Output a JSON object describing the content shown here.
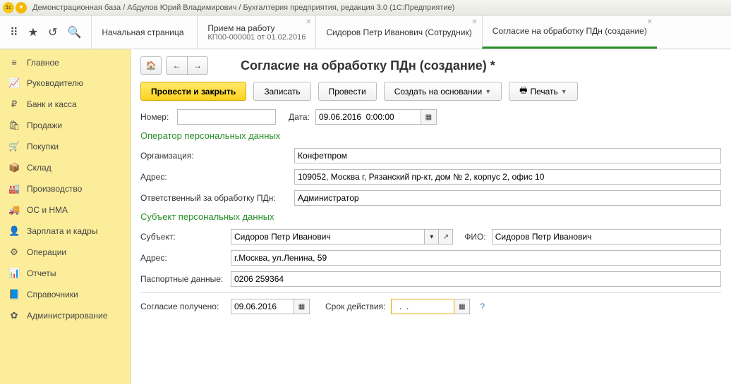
{
  "titlebar": {
    "text": "Демонстрационная база / Абдулов Юрий Владимирович / Бухгалтерия предприятия, редакция 3.0  (1С:Предприятие)"
  },
  "tabs": [
    {
      "title": "Начальная страница",
      "sub": ""
    },
    {
      "title": "Прием на работу",
      "sub": "КП00-000001 от 01.02.2016"
    },
    {
      "title": "Сидоров Петр Иванович (Сотрудник)",
      "sub": ""
    },
    {
      "title": "Согласие на обработку ПДн (создание)",
      "sub": ""
    }
  ],
  "sidebar": [
    {
      "icon": "≡",
      "label": "Главное"
    },
    {
      "icon": "📈",
      "label": "Руководителю"
    },
    {
      "icon": "₽",
      "label": "Банк и касса"
    },
    {
      "icon": "🛍",
      "label": "Продажи"
    },
    {
      "icon": "🛒",
      "label": "Покупки"
    },
    {
      "icon": "📦",
      "label": "Склад"
    },
    {
      "icon": "🏭",
      "label": "Производство"
    },
    {
      "icon": "🚚",
      "label": "ОС и НМА"
    },
    {
      "icon": "👤",
      "label": "Зарплата и кадры"
    },
    {
      "icon": "⚙",
      "label": "Операции"
    },
    {
      "icon": "📊",
      "label": "Отчеты"
    },
    {
      "icon": "📘",
      "label": "Справочники"
    },
    {
      "icon": "✿",
      "label": "Администрирование"
    }
  ],
  "page": {
    "title": "Согласие на обработку ПДн (создание) *",
    "toolbar": {
      "primary": "Провести и закрыть",
      "save": "Записать",
      "post": "Провести",
      "create_based": "Создать на основании",
      "print": "Печать"
    },
    "labels": {
      "number": "Номер:",
      "date": "Дата:",
      "section_operator": "Оператор персональных данных",
      "org": "Организация:",
      "addr": "Адрес:",
      "responsible": "Ответственный за обработку ПДн:",
      "section_subject": "Субъект персональных данных",
      "subject": "Субъект:",
      "fio": "ФИО:",
      "subject_addr": "Адрес:",
      "passport": "Паспортные данные:",
      "consent_received": "Согласие получено:",
      "validity": "Срок действия:"
    },
    "values": {
      "number": "",
      "date": "09.06.2016  0:00:00",
      "org": "Конфетпром",
      "addr": "109052, Москва г, Рязанский пр-кт, дом № 2, корпус 2, офис 10",
      "responsible": "Администратор",
      "subject": "Сидоров Петр Иванович",
      "fio": "Сидоров Петр Иванович",
      "subject_addr": "г.Москва, ул.Ленина, 59",
      "passport": "0206 259364",
      "consent_received": "09.06.2016",
      "validity": "  .  .    "
    }
  }
}
